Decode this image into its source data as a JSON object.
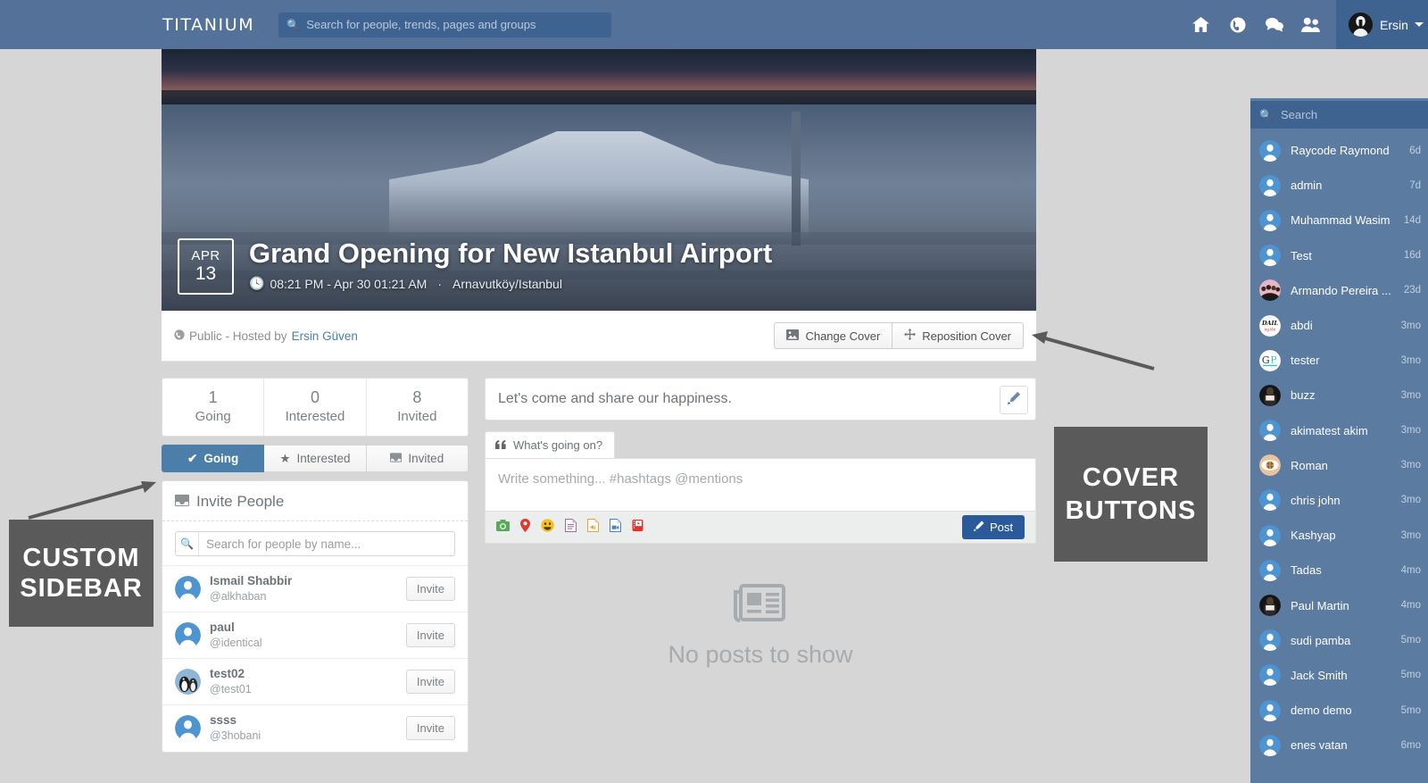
{
  "topnav": {
    "brand": "TITANIUM",
    "search_placeholder": "Search for people, trends, pages and groups",
    "search_value": "",
    "icons": [
      "home-icon",
      "globe-icon",
      "chat-icon",
      "friends-icon"
    ],
    "user_name": "Ersin"
  },
  "event": {
    "date_month": "APR",
    "date_day": "13",
    "title": "Grand Opening for New Istanbul Airport",
    "time": "08:21 PM - Apr 30 01:21 AM",
    "separator": "·",
    "location": "Arnavutköy/Istanbul",
    "privacy": "Public - Hosted by",
    "host": "Ersin Güven",
    "change_cover": "Change Cover",
    "reposition_cover": "Reposition Cover"
  },
  "stats": [
    {
      "number": "1",
      "label": "Going"
    },
    {
      "number": "0",
      "label": "Interested"
    },
    {
      "number": "8",
      "label": "Invited"
    }
  ],
  "tabs": [
    {
      "label": "Going",
      "icon": "check-icon",
      "active": true
    },
    {
      "label": "Interested",
      "icon": "star-icon",
      "active": false
    },
    {
      "label": "Invited",
      "icon": "inbox-icon",
      "active": false
    }
  ],
  "invite": {
    "title": "Invite People",
    "search_placeholder": "Search for people by name...",
    "search_value": "",
    "button_label": "Invite",
    "people": [
      {
        "name": "Ismail Shabbir",
        "username": "@alkhaban",
        "avatar": "default"
      },
      {
        "name": "paul",
        "username": "@identical",
        "avatar": "default"
      },
      {
        "name": "test02",
        "username": "@test01",
        "avatar": "penguin"
      },
      {
        "name": "ssss",
        "username": "@3hobani",
        "avatar": "default"
      }
    ]
  },
  "main": {
    "description": "Let's come and share our happiness.",
    "edit_icon": "pencil-icon",
    "composer_tab": "What's going on?",
    "composer_placeholder": "Write something... #hashtags @mentions",
    "composer_value": "",
    "post_label": "Post",
    "composer_icons": [
      "photo-icon",
      "location-icon",
      "emoji-icon",
      "document-icon",
      "audio-icon",
      "video-icon",
      "youtube-icon"
    ],
    "empty_text": "No posts to show",
    "empty_icon": "newspaper-icon"
  },
  "chat": {
    "search_placeholder": "Search",
    "search_value": "",
    "settings_icon": "gear-icon",
    "contacts": [
      {
        "name": "Raycode Raymond",
        "time": "6d",
        "avatar": "default"
      },
      {
        "name": "admin",
        "time": "7d",
        "avatar": "default"
      },
      {
        "name": "Muhammad Wasim",
        "time": "14d",
        "avatar": "default"
      },
      {
        "name": "Test",
        "time": "16d",
        "avatar": "default"
      },
      {
        "name": "Armando Pereira ...",
        "time": "23d",
        "avatar": "group-pink"
      },
      {
        "name": "abdi",
        "time": "3mo",
        "avatar": "daily"
      },
      {
        "name": "tester",
        "time": "3mo",
        "avatar": "gp"
      },
      {
        "name": "buzz",
        "time": "3mo",
        "avatar": "dark"
      },
      {
        "name": "akimatest akim",
        "time": "3mo",
        "avatar": "default"
      },
      {
        "name": "Roman",
        "time": "3mo",
        "avatar": "eye"
      },
      {
        "name": "chris john",
        "time": "3mo",
        "avatar": "default"
      },
      {
        "name": "Kashyap",
        "time": "3mo",
        "avatar": "default"
      },
      {
        "name": "Tadas",
        "time": "4mo",
        "avatar": "default"
      },
      {
        "name": "Paul Martin",
        "time": "4mo",
        "avatar": "dark"
      },
      {
        "name": "sudi pamba",
        "time": "5mo",
        "avatar": "default"
      },
      {
        "name": "Jack Smith",
        "time": "5mo",
        "avatar": "default"
      },
      {
        "name": "demo demo",
        "time": "5mo",
        "avatar": "default"
      },
      {
        "name": "enes vatan",
        "time": "6mo",
        "avatar": "default"
      }
    ]
  },
  "annotations": [
    {
      "id": "anno-sidebar",
      "line1": "CUSTOM",
      "line2": "SIDEBAR"
    },
    {
      "id": "anno-cover",
      "line1": "COVER",
      "line2": "BUTTONS"
    }
  ],
  "colors": {
    "nav_bg": "#547299",
    "nav_search_bg": "#3f6390",
    "accent_blue": "#4b7ea8",
    "post_blue": "#2a5a9a",
    "chat_bg": "#5b7ba1",
    "page_bg": "#d6d6d6",
    "annotation_bg": "#5a5a5a"
  }
}
